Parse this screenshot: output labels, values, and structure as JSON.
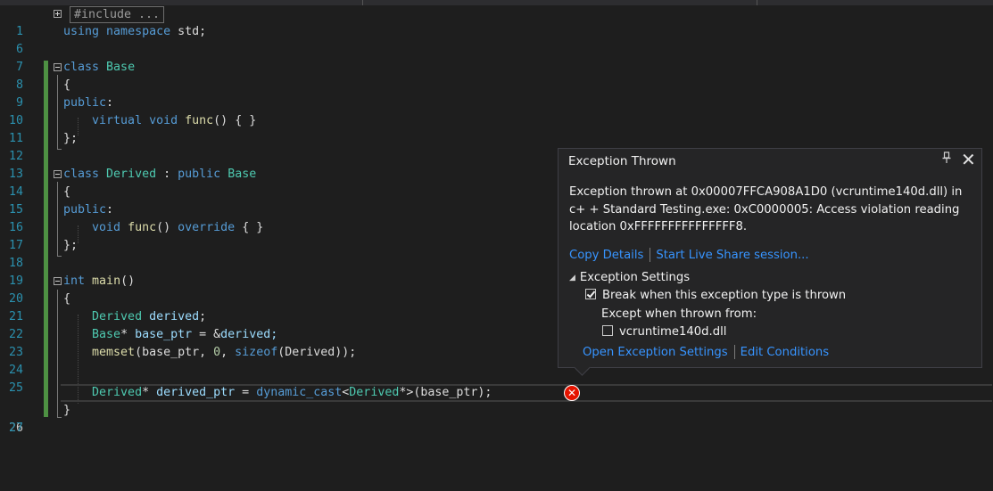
{
  "editor": {
    "lines": [
      {
        "num": "1"
      },
      {
        "num": "6"
      },
      {
        "num": "7"
      },
      {
        "num": "8"
      },
      {
        "num": "9"
      },
      {
        "num": "10"
      },
      {
        "num": "11"
      },
      {
        "num": "12"
      },
      {
        "num": "13"
      },
      {
        "num": "14"
      },
      {
        "num": "15"
      },
      {
        "num": "16"
      },
      {
        "num": "17"
      },
      {
        "num": "18"
      },
      {
        "num": "19"
      },
      {
        "num": "20"
      },
      {
        "num": "21"
      },
      {
        "num": "22"
      },
      {
        "num": "23"
      },
      {
        "num": "24"
      },
      {
        "num": "25"
      },
      {
        "num": "26"
      },
      {
        "num": "27"
      }
    ],
    "collapsed_text": "#include ...",
    "tokens": {
      "using": "using",
      "namespace": "namespace",
      "std": " std;",
      "class": "class",
      "Base": "Base",
      "open_brace": "{",
      "public": "public",
      "colon": ":",
      "virtual": "virtual",
      "void": "void",
      "func": "func",
      "func_rest": "() { }",
      "close_brace_semi": "};",
      "Derived": "Derived",
      "colon_sep": " : ",
      "override": "override",
      "braces": " { }",
      "int": "int",
      "main": "main",
      "parens": "()",
      "derived_var": "derived",
      "semi": ";",
      "star": "*",
      "base_ptr": "base_ptr",
      "assign_amp": " = &",
      "derived_end": "derived;",
      "memset": "memset",
      "memset_args1": "(base_ptr, ",
      "zero": "0",
      "comma_sp": ", ",
      "sizeof": "sizeof",
      "memset_args2": "(Derived));",
      "derived_ptr": "derived_ptr",
      "assign": " = ",
      "dynamic_cast": "dynamic_cast",
      "lt": "<",
      "derived_star_gt": "*>",
      "base_ptr_call": "(base_ptr);",
      "close_brace": "}"
    }
  },
  "exception_popup": {
    "title": "Exception Thrown",
    "pin_icon": "pin-icon",
    "close_icon": "close-icon",
    "message": "Exception thrown at 0x00007FFCA908A1D0 (vcruntime140d.dll) in c+ + Standard Testing.exe: 0xC0000005: Access violation reading location 0xFFFFFFFFFFFFFFF8.",
    "copy_details": "Copy Details",
    "live_share": "Start Live Share session...",
    "settings_header": "Exception Settings",
    "break_when": "Break when this exception type is thrown",
    "break_checked": true,
    "except_when": "Except when thrown from:",
    "dll_name": "vcruntime140d.dll",
    "dll_checked": false,
    "open_settings": "Open Exception Settings",
    "edit_conditions": "Edit Conditions"
  },
  "colors": {
    "background": "#1e1e1e",
    "keyword": "#569cd6",
    "type": "#4ec9b0",
    "function": "#dcdcaa",
    "variable": "#9cdcfe",
    "link": "#3794ff",
    "error": "#e51400",
    "change_bar": "#57a64a"
  }
}
